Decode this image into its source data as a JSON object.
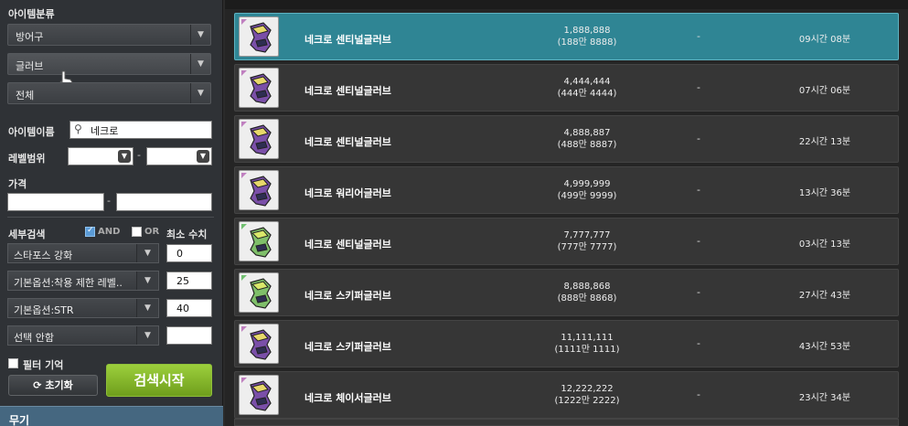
{
  "filters": {
    "category_label": "아이템분류",
    "category1": "방어구",
    "category2": "글러브",
    "category3": "전체",
    "item_name_label": "아이템이름",
    "item_name_value": "네크로",
    "level_range_label": "레벨범위",
    "level_sep": "-",
    "price_label": "가격",
    "price_sep": "-",
    "detail_label": "세부검색",
    "and_label": "AND",
    "or_label": "OR",
    "min_label": "최소 수치",
    "options": [
      {
        "label": "스타포스 강화",
        "value": "0"
      },
      {
        "label": "기본옵션:착용 제한 레벨..",
        "value": "25"
      },
      {
        "label": "기본옵션:STR",
        "value": "40"
      },
      {
        "label": "선택 안함",
        "value": ""
      }
    ],
    "filter_memory_label": "필터 기억",
    "reset_label": "초기화",
    "search_label": "검색시작",
    "bottom_category": "무기"
  },
  "list": {
    "rows": [
      {
        "name": "네크로 센티널글러브",
        "price": "1,888,888",
        "price_sub": "(188만 8888)",
        "dash": "-",
        "time": "09시간 08분",
        "icon": "purple-glove-icon",
        "selected": true
      },
      {
        "name": "네크로 센티널글러브",
        "price": "4,444,444",
        "price_sub": "(444만 4444)",
        "dash": "-",
        "time": "07시간 06분",
        "icon": "purple-glove-icon"
      },
      {
        "name": "네크로 센티널글러브",
        "price": "4,888,887",
        "price_sub": "(488만 8887)",
        "dash": "-",
        "time": "22시간 13분",
        "icon": "purple-glove-icon"
      },
      {
        "name": "네크로 워리어글러브",
        "price": "4,999,999",
        "price_sub": "(499만 9999)",
        "dash": "-",
        "time": "13시간 36분",
        "icon": "purple-glove-icon"
      },
      {
        "name": "네크로 센티널글러브",
        "price": "7,777,777",
        "price_sub": "(777만 7777)",
        "dash": "-",
        "time": "03시간 13분",
        "icon": "green-glove-icon"
      },
      {
        "name": "네크로 스키퍼글러브",
        "price": "8,888,868",
        "price_sub": "(888만 8868)",
        "dash": "-",
        "time": "27시간 43분",
        "icon": "green-glove-icon"
      },
      {
        "name": "네크로 스키퍼글러브",
        "price": "11,111,111",
        "price_sub": "(1111만 1111)",
        "dash": "-",
        "time": "43시간 53분",
        "icon": "purple-glove-icon"
      },
      {
        "name": "네크로 체이서글러브",
        "price": "12,222,222",
        "price_sub": "(1222만 2222)",
        "dash": "-",
        "time": "23시간 34분",
        "icon": "purple-glove-icon"
      }
    ]
  },
  "colors": {
    "selected_row": "#2f8594",
    "search_button": "#8cc63f",
    "panel_bg": "#2f3236"
  }
}
